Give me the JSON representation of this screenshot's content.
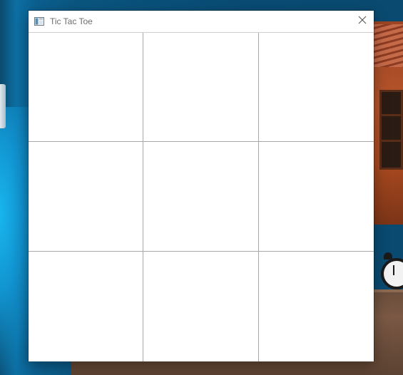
{
  "window": {
    "title": "Tic Tac Toe",
    "icon": "window-app-icon",
    "close_icon": "close-icon"
  },
  "board": {
    "rows": 3,
    "columns": 3,
    "cells": [
      "",
      "",
      "",
      "",
      "",
      "",
      "",
      "",
      ""
    ]
  },
  "colors": {
    "desktop_blue": "#0a557f",
    "window_bg": "#ffffff",
    "grid_line": "#a8a8a8",
    "title_text": "#6d6d6d"
  }
}
